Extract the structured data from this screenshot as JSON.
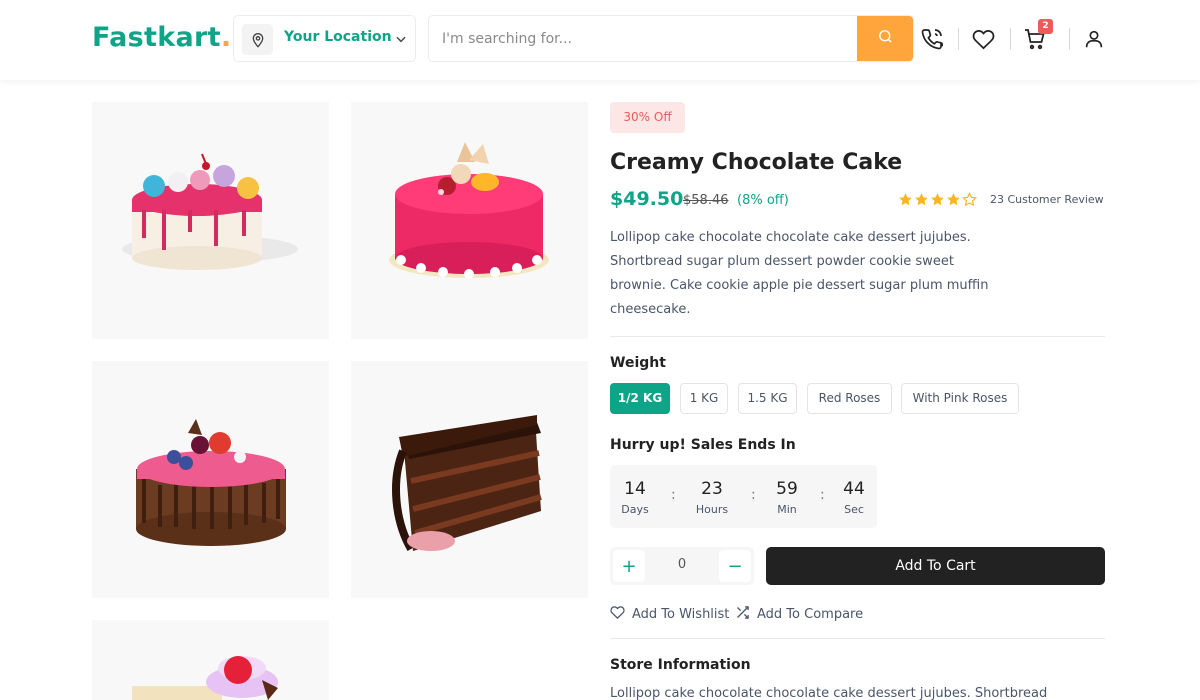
{
  "header": {
    "logo_main": "Fastkart",
    "logo_dot": ".",
    "location_label": "Your Location",
    "search_placeholder": "I'm searching for...",
    "cart_count": "2",
    "accent": "#0da487",
    "search_button_color": "#ffa53b",
    "icons": [
      "location-pin-icon",
      "chevron-down-icon",
      "search-icon",
      "phone-icon",
      "heart-icon",
      "cart-icon",
      "user-icon"
    ]
  },
  "gallery": {
    "images": [
      "Cake with pink drip and meringue kisses",
      "Pink glazed cake with fruit topping",
      "Pink cake with chocolate shavings and berries",
      "Chocolate layer cake slice",
      "Cake slice with cream and cherry"
    ]
  },
  "product": {
    "discount_badge": "30% Off",
    "title": "Creamy Chocolate Cake",
    "price": "$49.50",
    "old_price": "$58.46",
    "off_text": "(8% off)",
    "rating": 4,
    "rating_max": 5,
    "review_text": "23 Customer Review",
    "description": "Lollipop cake chocolate chocolate cake dessert jujubes. Shortbread sugar plum dessert powder cookie sweet brownie. Cake cookie apple pie dessert sugar plum muffin cheesecake."
  },
  "weight": {
    "label": "Weight",
    "options": [
      "1/2 KG",
      "1 KG",
      "1.5 KG",
      "Red Roses",
      "With Pink Roses"
    ],
    "selected": "1/2 KG"
  },
  "sale": {
    "label": "Hurry up! Sales Ends In",
    "units": [
      {
        "value": "14",
        "label": "Days"
      },
      {
        "value": "23",
        "label": "Hours"
      },
      {
        "value": "59",
        "label": "Min"
      },
      {
        "value": "44",
        "label": "Sec"
      }
    ],
    "separator": ":"
  },
  "cart": {
    "quantity": "0",
    "plus": "+",
    "minus": "−",
    "add_to_cart": "Add To Cart"
  },
  "links": {
    "wishlist": "Add To Wishlist",
    "compare": "Add To Compare"
  },
  "store": {
    "heading": "Store Information",
    "description": "Lollipop cake chocolate chocolate cake dessert jujubes. Shortbread"
  }
}
